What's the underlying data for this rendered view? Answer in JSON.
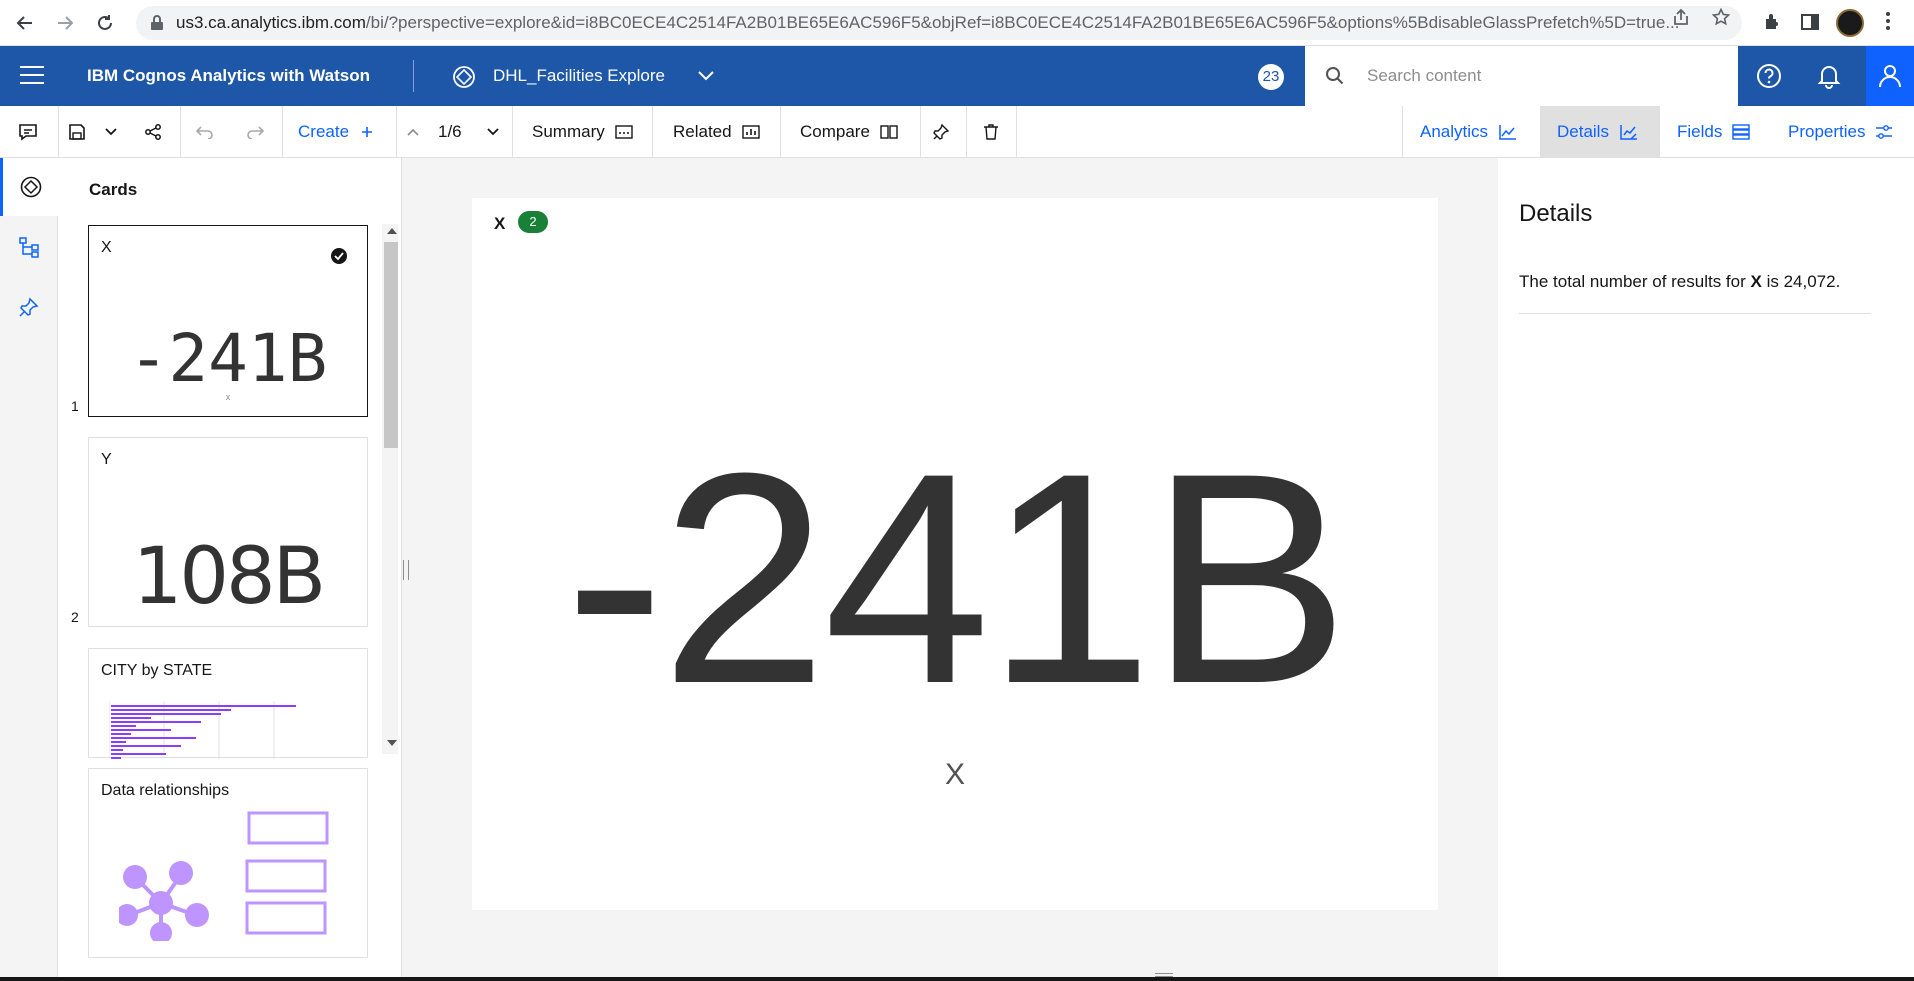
{
  "browser": {
    "url_host": "us3.ca.analytics.ibm.com",
    "url_path": "/bi/?perspective=explore&id=i8BC0ECE4C2514FA2B01BE65E6AC596F5&objRef=i8BC0ECE4C2514FA2B01BE65E6AC596F5&options%5BdisableGlassPrefetch%5D=true..."
  },
  "header": {
    "brand": "IBM Cognos Analytics with Watson",
    "asset_name": "DHL_Facilities Explore",
    "notification_count": "23",
    "search_placeholder": "Search content"
  },
  "toolbar": {
    "create_label": "Create",
    "page_indicator": "1/6",
    "summary_label": "Summary",
    "related_label": "Related",
    "compare_label": "Compare",
    "analytics_label": "Analytics",
    "details_label": "Details",
    "fields_label": "Fields",
    "properties_label": "Properties"
  },
  "cards_panel": {
    "title": "Cards",
    "cards": [
      {
        "number": "1",
        "title": "X",
        "value": "-241B",
        "sublabel": "x"
      },
      {
        "number": "2",
        "title": "Y",
        "value": "108B",
        "sublabel": ""
      },
      {
        "number": "",
        "title": "CITY by STATE"
      },
      {
        "number": "",
        "title": "Data relationships"
      }
    ]
  },
  "main_card": {
    "title": "X",
    "badge": "2",
    "value": "-241B",
    "label": "X"
  },
  "details": {
    "title": "Details",
    "text_prefix": "The total number of results for ",
    "text_field": "X",
    "text_mid": " is ",
    "text_value": "24,072."
  },
  "colors": {
    "header_bg": "#1e57a8",
    "accent": "#0f62fe",
    "badge_green": "#198038",
    "chart_purple": "#8a3ffc",
    "relationship_purple": "#be95ff"
  }
}
